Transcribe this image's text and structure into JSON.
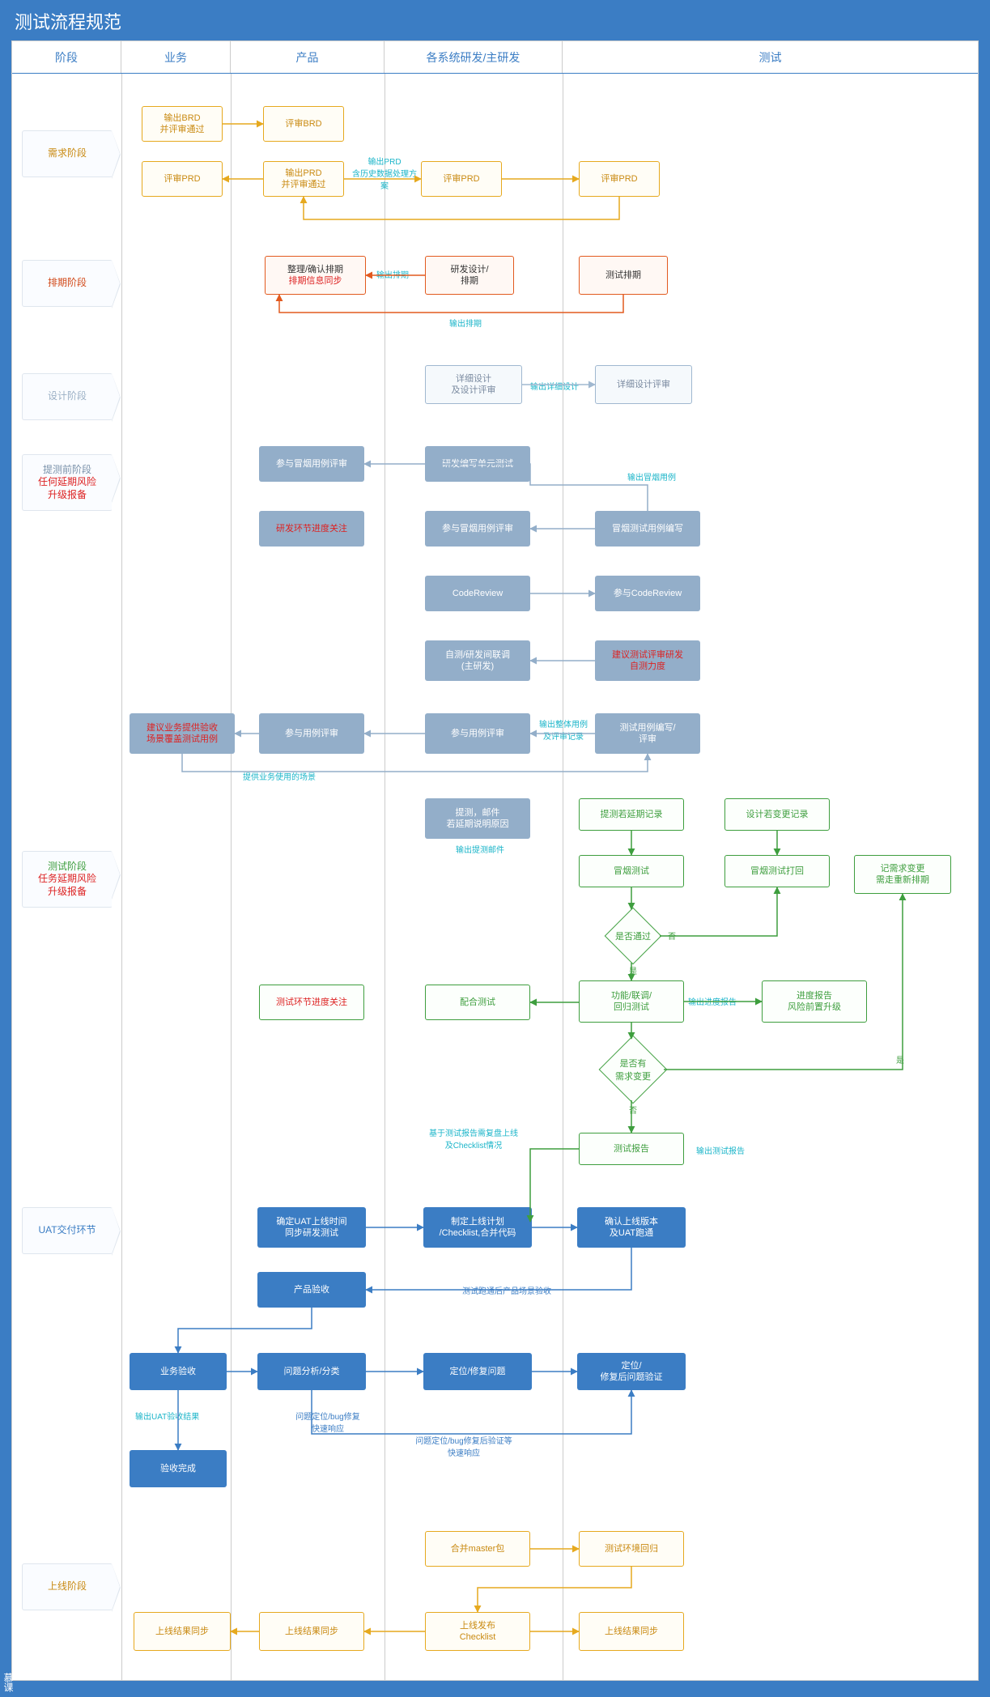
{
  "title": "测试流程规范",
  "columns": [
    "阶段",
    "业务",
    "产品",
    "各系统研发/主研发",
    "测试"
  ],
  "phases": {
    "p1": "需求阶段",
    "p2": "排期阶段",
    "p3": "设计阶段",
    "p4a": "提测前阶段",
    "p4b": "任何延期风险",
    "p4c": "升级报备",
    "p5a": "测试阶段",
    "p5b": "任务延期风险",
    "p5c": "升级报备",
    "p6": "UAT交付环节",
    "p7": "上线阶段"
  },
  "nodes": {
    "brd": "输出BRD\n并评审通过",
    "rbrd": "评审BRD",
    "prd": "输出PRD\n并评审通过",
    "rprd_b": "评审PRD",
    "rprd_d": "评审PRD",
    "rprd_t": "评审PRD",
    "sched_confirm": "整理/确认排期",
    "sched_sync": "排期信息同步",
    "dev_sched": "研发设计/\n排期",
    "test_sched": "测试排期",
    "design": "详细设计\n及设计评审",
    "design_rev": "详细设计评审",
    "smoke_rev": "参与冒烟用例评审",
    "unit": "研发编写单元测试",
    "dev_focus": "研发环节进度关注",
    "smoke_rev2": "参与冒烟用例评审",
    "smoke_write": "冒烟测试用例编写",
    "codereview": "CodeReview",
    "cr_part": "参与CodeReview",
    "selftest": "自测/研发间联调\n(主研发)",
    "suggest_self": "建议测试评审研发\n自测力度",
    "biz_case": "建议业务提供验收\n场景覆盖测试用例",
    "case_rev1": "参与用例评审",
    "case_rev2": "参与用例评审",
    "case_write": "测试用例编写/\n评审",
    "submit": "提测，邮件\n若延期说明原因",
    "delay_rec": "提测若延期记录",
    "design_chg": "设计若变更记录",
    "smoke_test": "冒烟测试",
    "smoke_back": "冒烟测试打回",
    "req_chg": "记需求变更\n需走重新排期",
    "test_focus": "测试环节进度关注",
    "fix_test": "配合测试",
    "func_test": "功能/联调/\n回归测试",
    "progress": "进度报告\n风险前置升级",
    "report": "测试报告",
    "uat_time": "确定UAT上线时间\n同步研发测试",
    "uat_plan": "制定上线计划\n/Checklist,合并代码",
    "uat_ver": "确认上线版本\n及UAT跑通",
    "prod_accept": "产品验收",
    "biz_accept": "业务验收",
    "issue_ana": "问题分析/分类",
    "fix_issue": "定位/修复问题",
    "fix_verify": "定位/\n修复后问题验证",
    "accept_done": "验收完成",
    "merge": "合并master包",
    "regress": "测试环境回归",
    "launch_ck": "上线发布\nChecklist",
    "sync1": "上线结果同步",
    "sync2": "上线结果同步",
    "sync3": "上线结果同步"
  },
  "labels": {
    "l_prd": "输出PRD\n含历史数据处理方案",
    "l_sched1": "输出排期",
    "l_sched2": "输出排期",
    "l_design": "输出详细设计",
    "l_smoke": "输出冒烟用例",
    "l_case": "输出整体用例\n及评审记录",
    "l_bizcase": "提供业务使用的场景",
    "l_submit": "输出提测邮件",
    "l_pass": "是否通过",
    "l_yes": "是",
    "l_no": "否",
    "l_haschg": "是否有\n需求变更",
    "l_no2": "否",
    "l_yes2": "是",
    "l_prog": "输出进度报告",
    "l_report": "输出测试报告",
    "l_basecheck": "基于测试报告需复盘上线\n及Checklist情况",
    "l_uatflow": "测试跑通后产品场景验收",
    "l_uatres": "输出UAT验收结果",
    "l_fixfast": "问题定位/bug修复\n快速响应",
    "l_verifyfast": "问题定位/bug修复后验证等\n快速响应"
  },
  "watermark": "慕课"
}
